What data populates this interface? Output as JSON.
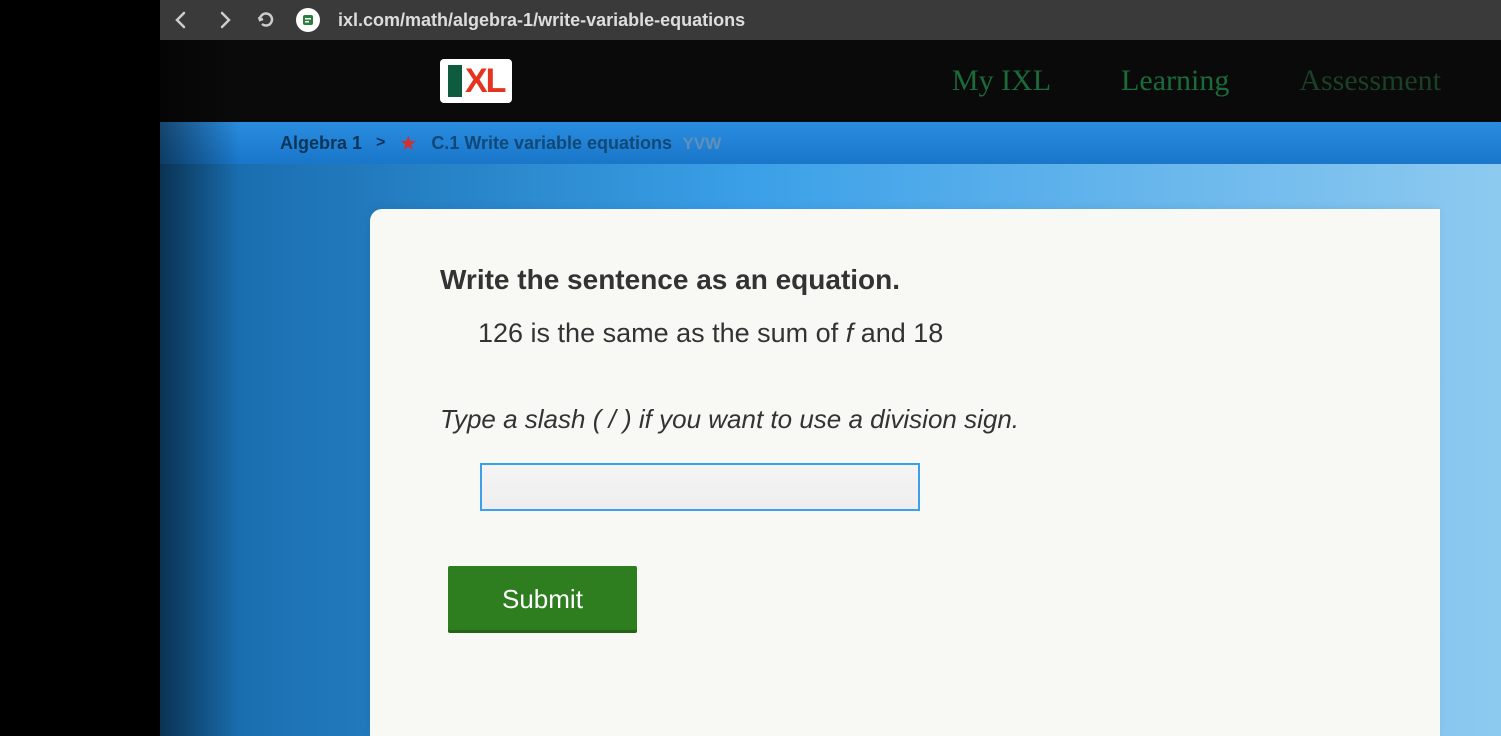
{
  "browser": {
    "url": "ixl.com/math/algebra-1/write-variable-equations"
  },
  "header": {
    "logo_i": "I",
    "logo_xl": "XL",
    "nav": {
      "my_ixl": "My IXL",
      "learning": "Learning",
      "assessment": "Assessment"
    }
  },
  "breadcrumb": {
    "subject": "Algebra 1",
    "separator": ">",
    "skill_title": "C.1 Write variable equations",
    "skill_code": "YVW"
  },
  "question": {
    "prompt": "Write the sentence as an equation.",
    "sentence_part1": "126 is the same as the sum of ",
    "sentence_var": "f",
    "sentence_part2": " and 18",
    "hint": "Type a slash ( / ) if you want to use a division sign.",
    "submit_label": "Submit",
    "input_value": ""
  }
}
